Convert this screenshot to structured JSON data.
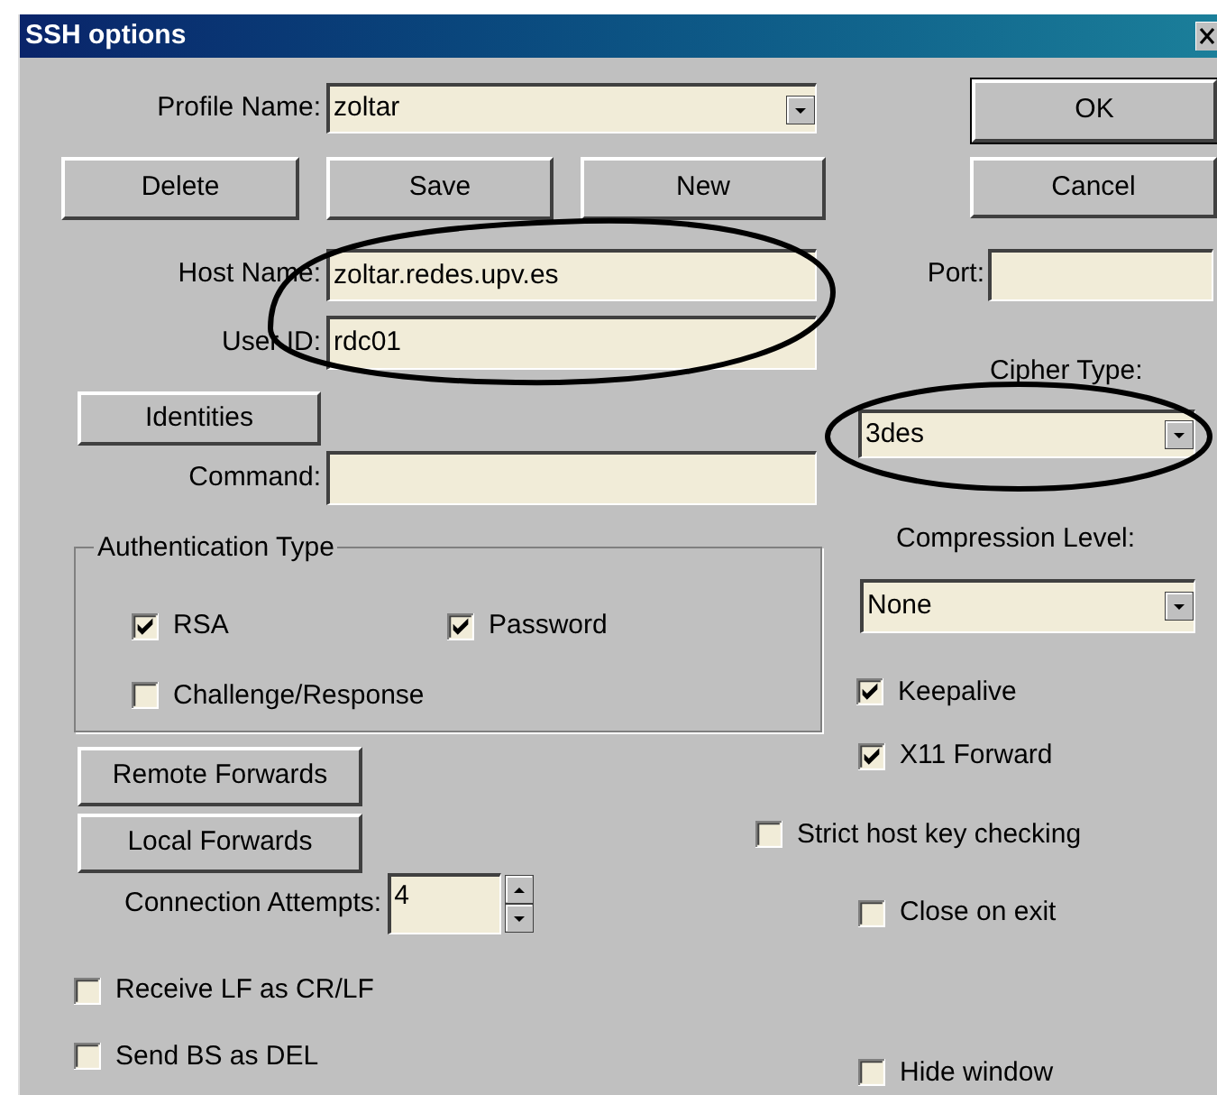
{
  "window": {
    "title": "SSH options"
  },
  "profile": {
    "label": "Profile Name:",
    "value": "zoltar"
  },
  "buttons": {
    "ok": "OK",
    "cancel": "Cancel",
    "delete": "Delete",
    "save": "Save",
    "new": "New",
    "identities": "Identities",
    "remote_forwards": "Remote Forwards",
    "local_forwards": "Local Forwards"
  },
  "host": {
    "label": "Host Name:",
    "value": "zoltar.redes.upv.es"
  },
  "port": {
    "label": "Port:"
  },
  "user": {
    "label": "User ID:",
    "value": "rdc01"
  },
  "cipher": {
    "label": "Cipher Type:",
    "value": "3des"
  },
  "command": {
    "label": "Command:"
  },
  "auth": {
    "title": "Authentication Type",
    "options": [
      {
        "label": "RSA",
        "checked": true
      },
      {
        "label": "Password",
        "checked": true
      },
      {
        "label": "Challenge/Response",
        "checked": false
      }
    ]
  },
  "compression": {
    "label": "Compression Level:",
    "value": "None"
  },
  "attempts": {
    "label": "Connection Attempts:",
    "value": "4"
  },
  "options": [
    {
      "label": "Keepalive",
      "checked": true
    },
    {
      "label": "X11 Forward",
      "checked": true
    },
    {
      "label": "Strict host key checking",
      "checked": false
    },
    {
      "label": "Close on exit",
      "checked": false
    },
    {
      "label": "Receive LF as CR/LF",
      "checked": false
    },
    {
      "label": "Send BS as DEL",
      "checked": false
    },
    {
      "label": "Hide window",
      "checked": false
    }
  ]
}
